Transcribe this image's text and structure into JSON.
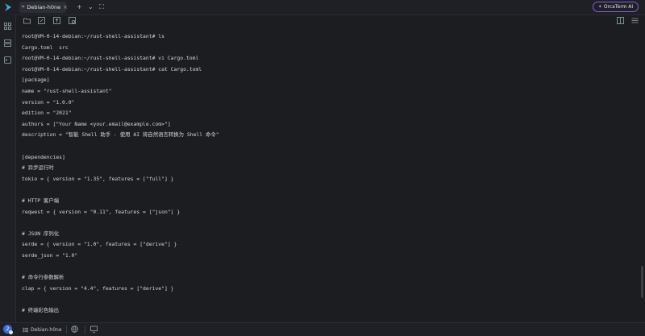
{
  "titlebar": {
    "tab_label": "Debian-h0ne",
    "tab_close": "×",
    "ai_button_label": "OrcaTerm AI",
    "new_tab": "+",
    "dropdown": "⌄",
    "fullscreen": "⛶",
    "minimize": "–"
  },
  "terminal": {
    "lines": [
      "root@VM-0-14-debian:~/rust-shell-assistant# ls",
      "Cargo.toml  src",
      "root@VM-0-14-debian:~/rust-shell-assistant# vi Cargo.toml",
      "root@VM-0-14-debian:~/rust-shell-assistant# cat Cargo.toml",
      "[package]",
      "name = \"rust-shell-assistant\"",
      "version = \"1.0.0\"",
      "edition = \"2021\"",
      "authors = [\"Your Name <your.email@example.com>\"]",
      "description = \"智能 Shell 助手 - 使用 AI 将自然语言转换为 Shell 命令\"",
      "",
      "[dependencies]",
      "# 异步运行时",
      "tokio = { version = \"1.35\", features = [\"full\"] }",
      "",
      "# HTTP 客户端",
      "reqwest = { version = \"0.11\", features = [\"json\"] }",
      "",
      "# JSON 序列化",
      "serde = { version = \"1.0\", features = [\"derive\"] }",
      "serde_json = \"1.0\"",
      "",
      "# 命令行参数解析",
      "clap = { version = \"4.4\", features = [\"derive\"] }",
      "",
      "# 终端彩色输出"
    ]
  },
  "statusbar": {
    "avatar_initial": "2",
    "session_label": "Debian-h0ne"
  },
  "colors": {
    "background": "#1b1d21",
    "accent_purple": "#8a5cd6",
    "avatar_blue": "#3d6ee0"
  }
}
